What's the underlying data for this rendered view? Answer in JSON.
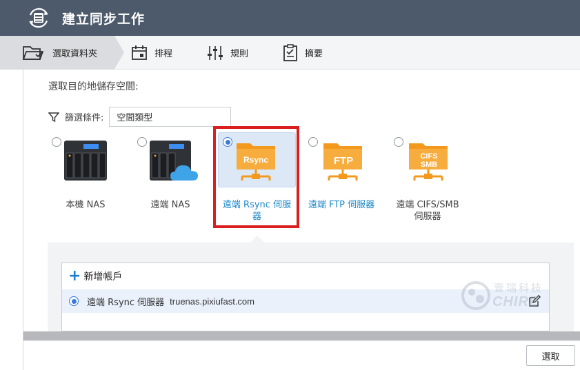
{
  "window": {
    "title": "建立同步工作"
  },
  "steps": [
    {
      "label": "選取資料夾",
      "icon": "folder-icon",
      "active": true
    },
    {
      "label": "排程",
      "icon": "calendar-icon",
      "active": false
    },
    {
      "label": "規則",
      "icon": "sliders-icon",
      "active": false
    },
    {
      "label": "摘要",
      "icon": "clipboard-icon",
      "active": false
    }
  ],
  "prompt": "選取目的地儲存空間:",
  "filter": {
    "label": "篩選條件:",
    "value": "空間類型"
  },
  "destinations": [
    {
      "label": "本機 NAS",
      "icon": "nas-device-icon",
      "checked": false,
      "style": "plain"
    },
    {
      "label": "遠端 NAS",
      "icon": "nas-cloud-icon",
      "checked": false,
      "style": "plain"
    },
    {
      "label_line1": "遠端 Rsync 伺服",
      "label_line2": "器",
      "badge": "Rsync",
      "icon": "rsync-folder-icon",
      "checked": true,
      "style": "link"
    },
    {
      "label": "遠端 FTP 伺服器",
      "badge": "FTP",
      "icon": "ftp-folder-icon",
      "checked": false,
      "style": "link"
    },
    {
      "label_line1": "遠端 CIFS/SMB",
      "label_line2": "伺服器",
      "badge_line1": "CIFS",
      "badge_line2": "SMB",
      "icon": "cifs-folder-icon",
      "checked": false,
      "style": "plain"
    }
  ],
  "accounts": {
    "add_label": "新增帳戶",
    "rows": [
      {
        "type": "遠端 Rsync 伺服器",
        "host": "truenas.pixiufast.com",
        "checked": true
      }
    ]
  },
  "watermark": {
    "text": "壹瑞科技",
    "latin": "CHIRE"
  },
  "footer": {
    "select_label": "選取"
  },
  "colors": {
    "titlebar": "#4d5a6b",
    "accent": "#3a7ad9",
    "link": "#1a87c9",
    "highlight": "#d9201f",
    "folder": "#f39a1e"
  }
}
